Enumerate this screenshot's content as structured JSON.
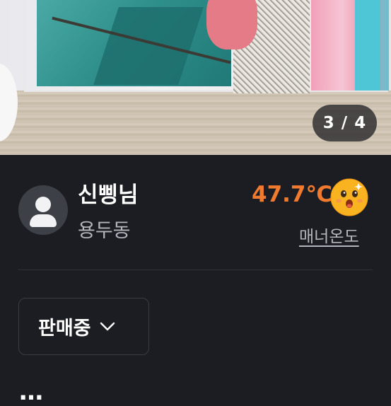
{
  "photo": {
    "counter": "3 / 4"
  },
  "seller": {
    "name": "신삥님",
    "location": "용두동",
    "temperature": "47.7℃",
    "temperature_label": "매너온도"
  },
  "listing": {
    "status_label": "판매중",
    "title_partial": "…"
  },
  "colors": {
    "background": "#1c1d22",
    "temperature": "#f27a2f",
    "muted_text": "#b3b6bd"
  }
}
